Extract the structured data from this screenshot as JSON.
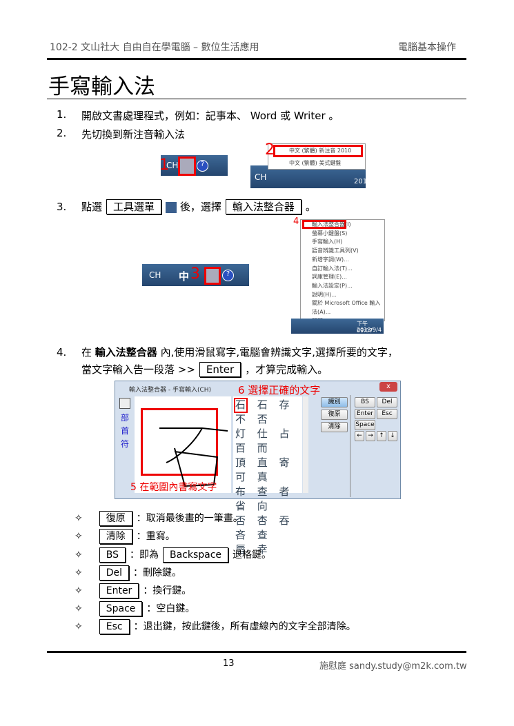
{
  "header": {
    "left": "102-2 文山社大 自由自在學電腦 – 數位生活應用",
    "right": "電腦基本操作"
  },
  "title": "手寫輸入法",
  "steps": [
    {
      "num": "1.",
      "text": "開啟文書處理程式，例如：記事本、 Word 或 Writer 。"
    },
    {
      "num": "2.",
      "text": "先切換到新注音輸入法"
    },
    {
      "num": "3.",
      "pre": "點選",
      "key1": "工具選單",
      "mid": "後，選擇",
      "key2": "輸入法整合器",
      "post": "。"
    },
    {
      "num": "4.",
      "pre": "在",
      "bold": "輸入法整合器",
      "post": "內,使用滑鼠寫字,電腦會辨識文字,選擇所要的文字，",
      "line2pre": "當文字輸入告一段落 >>",
      "key": "Enter",
      "line2post": "，才算完成輸入。"
    }
  ],
  "shot1": {
    "label": "CH",
    "marker": "1"
  },
  "shot2": {
    "marker": "2",
    "item1": "中文 (繁體) 新注音 2010",
    "item2": "中文 (繁體) 美式鍵盤",
    "tray": "CH",
    "clock": "201"
  },
  "shot3": {
    "label": "CH",
    "zh": "中",
    "marker": "3"
  },
  "shot4": {
    "marker": "4",
    "items": [
      "輸入法整合器(I)",
      "螢幕小鍵盤(S)",
      "手寫輸入(H)",
      "語音辨識工具列(V)",
      "新增字詞(W)...",
      "自訂輸入法(T)...",
      "詞庫管理(E)...",
      "輸入法設定(P)...",
      "說明(H)...",
      "關於 Microsoft Office 輸入法(A)...",
      "關閉"
    ],
    "time": "下午 09:07",
    "date": "2013/9/4"
  },
  "ime": {
    "title": "輸入法整合器 - 手寫輸入(CH)",
    "close": "x",
    "side": [
      "部",
      "首",
      "符"
    ],
    "marker5": "5 在範圍內書寫文字",
    "marker6": "6 選擇正確的文字",
    "candidates": [
      "石 石 存 不 否",
      "灯 仕 占 百 而",
      "頂 直 寄 可 真",
      "布 查 者 省 向",
      "否 杏 吞 吝 查",
      "唇 幸"
    ],
    "buttons": {
      "recognize": "識別",
      "undo": "復原",
      "clear": "清除",
      "bs": "BS",
      "del": "Del",
      "enter": "Enter",
      "esc": "Esc",
      "space": "Space"
    },
    "arrows": [
      "←",
      "→",
      "↑",
      "↓"
    ]
  },
  "bullets": [
    {
      "key": "復原",
      "text": "：取消最後畫的一筆畫。"
    },
    {
      "key": "清除",
      "text": "：重寫。"
    },
    {
      "key": "BS",
      "text": "：即為",
      "key2": "Backspace",
      "text2": "退格鍵。"
    },
    {
      "key": "Del",
      "text": "：刪除鍵。"
    },
    {
      "key": "Enter",
      "text": "：換行鍵。"
    },
    {
      "key": "Space",
      "text": "：空白鍵。"
    },
    {
      "key": "Esc",
      "text": "：退出鍵，按此鍵後，所有虛線內的文字全部清除。"
    }
  ],
  "bullet_symbol": "✧",
  "footer": {
    "page": "13",
    "author": "施慰庭 sandy.study@m2k.com.tw"
  }
}
